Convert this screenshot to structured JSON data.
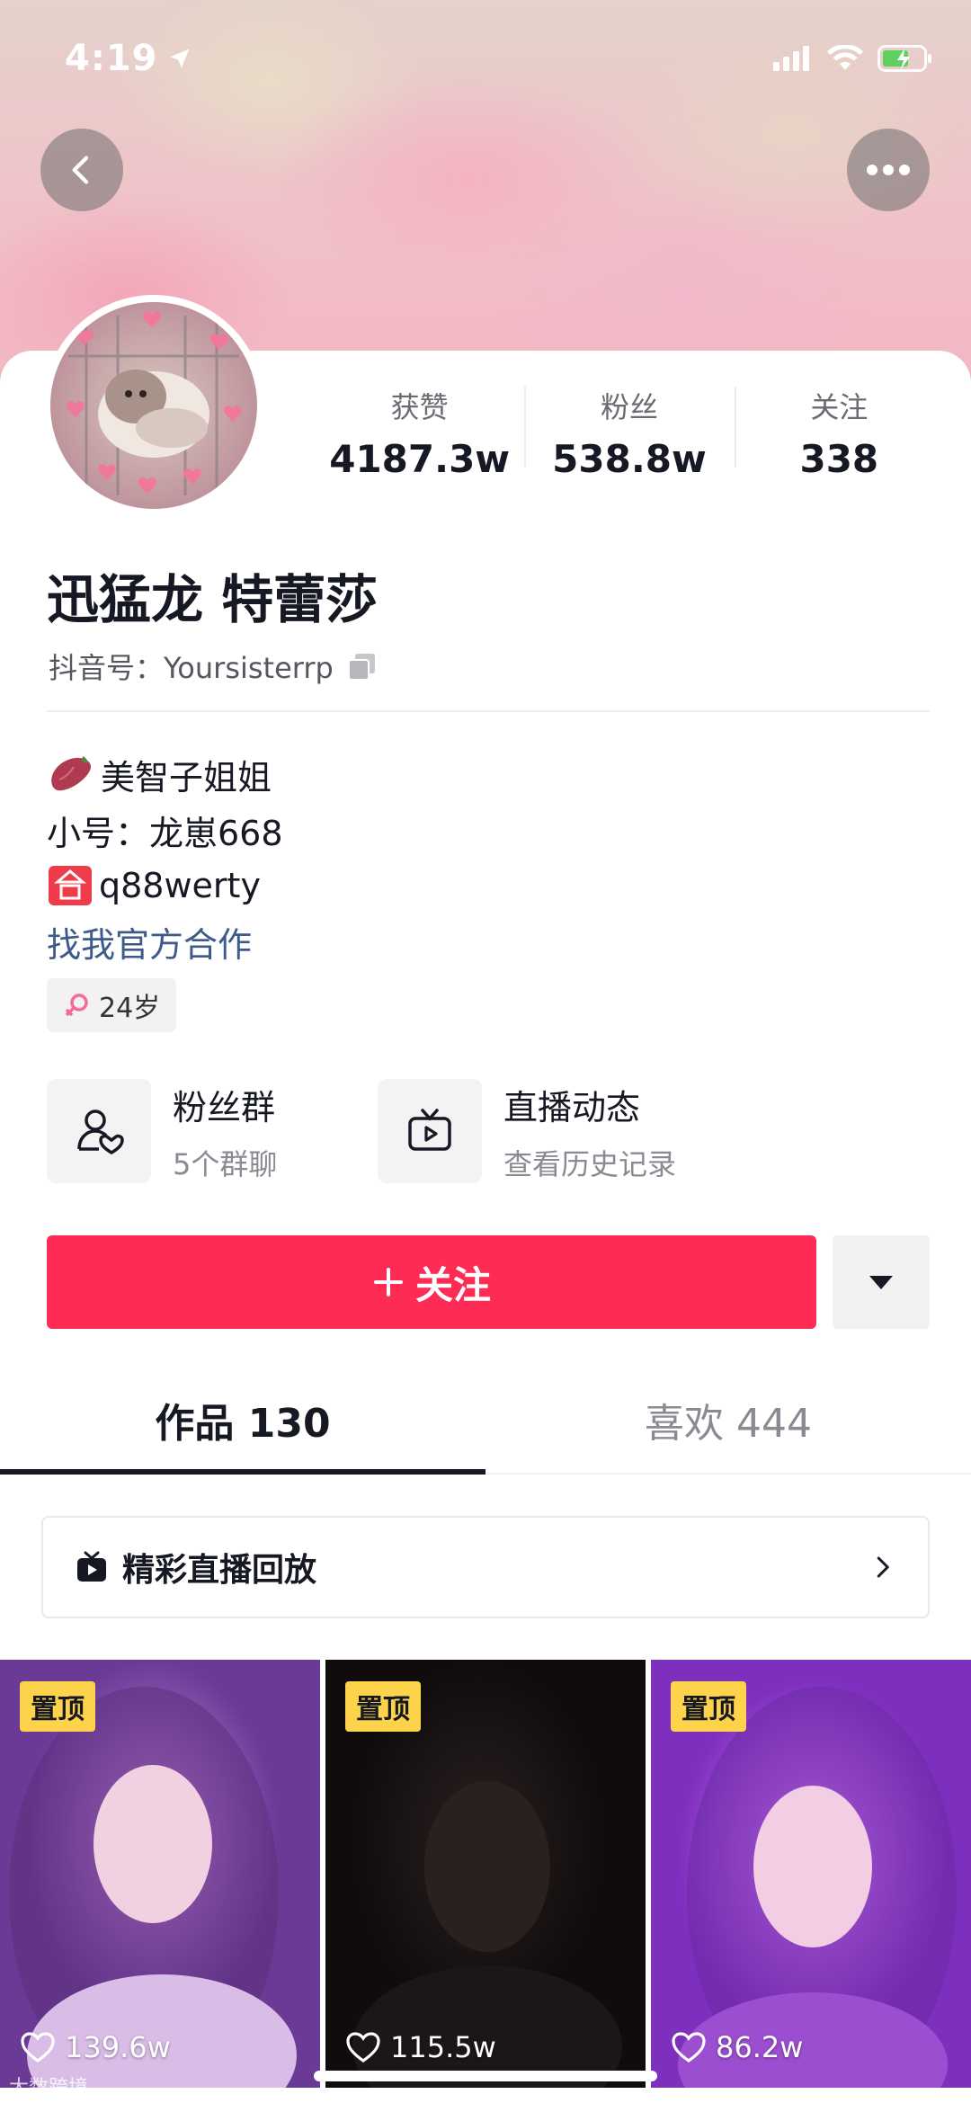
{
  "status_bar": {
    "time": "4:19"
  },
  "profile": {
    "stats": [
      {
        "label": "获赞",
        "value": "4187.3w"
      },
      {
        "label": "粉丝",
        "value": "538.8w"
      },
      {
        "label": "关注",
        "value": "338"
      }
    ],
    "nickname": "迅猛龙 特蕾莎",
    "douyin_id": "抖音号：Yoursisterrp",
    "bio": {
      "line1": "美智子姐姐",
      "line2": "小号：龙崽668",
      "line3": "q88werty",
      "link": "找我官方合作",
      "age": "24岁"
    },
    "entries": [
      {
        "title": "粉丝群",
        "sub": "5个群聊"
      },
      {
        "title": "直播动态",
        "sub": "查看历史记录"
      }
    ],
    "follow_label": "关注"
  },
  "tabs": [
    {
      "label": "作品 130"
    },
    {
      "label": "喜欢 444"
    }
  ],
  "replay": {
    "label": "精彩直播回放"
  },
  "videos": [
    {
      "badge": "置顶",
      "likes": "139.6w"
    },
    {
      "badge": "置顶",
      "likes": "115.5w"
    },
    {
      "badge": "置顶",
      "likes": "86.2w"
    }
  ],
  "watermark": "大数跨境",
  "colors": {
    "accent": "#fe2c55",
    "pin": "#fcd34a",
    "link": "#3c5a8a"
  }
}
